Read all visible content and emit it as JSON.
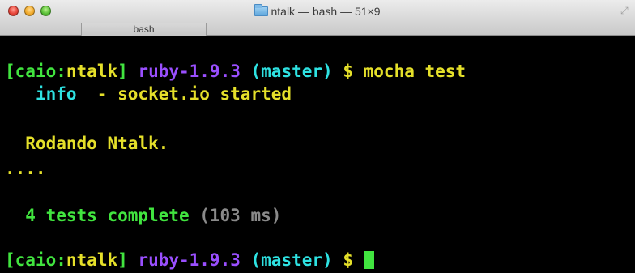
{
  "window": {
    "title": "ntalk — bash — 51×9",
    "tab_label": "bash"
  },
  "terminal": {
    "line1": {
      "open_bracket": "[",
      "user": "caio",
      "colon": ":",
      "dir": "ntalk",
      "close_bracket": "]",
      "space1": " ",
      "ruby": "ruby-1.9.3",
      "space2": " ",
      "branch": "(master)",
      "space3": " ",
      "prompt": "$",
      "space4": " ",
      "command": "mocha test"
    },
    "line2": {
      "indent": "   ",
      "level": "info",
      "message": "  - socket.io started"
    },
    "line3": {
      "indent": "  ",
      "text": "Rodando Ntalk."
    },
    "line4": {
      "dots": "...."
    },
    "line5": {
      "indent": "  ",
      "summary": "4 tests complete",
      "space": " ",
      "timing": "(103 ms)"
    },
    "line6": {
      "open_bracket": "[",
      "user": "caio",
      "colon": ":",
      "dir": "ntalk",
      "close_bracket": "]",
      "space1": " ",
      "ruby": "ruby-1.9.3",
      "space2": " ",
      "branch": "(master)",
      "space3": " ",
      "prompt": "$",
      "space4": " "
    }
  },
  "colors": {
    "green": "#41e43f",
    "yellow": "#e5e02a",
    "purple": "#9a4fff",
    "cyan": "#2ee2e2",
    "gray": "#8a8a8a",
    "background": "#000000"
  },
  "icons": {
    "close": "close-button-red",
    "minimize": "minimize-button-yellow",
    "zoom": "zoom-button-green",
    "folder": "folder-icon",
    "resize": "fullscreen-icon"
  }
}
